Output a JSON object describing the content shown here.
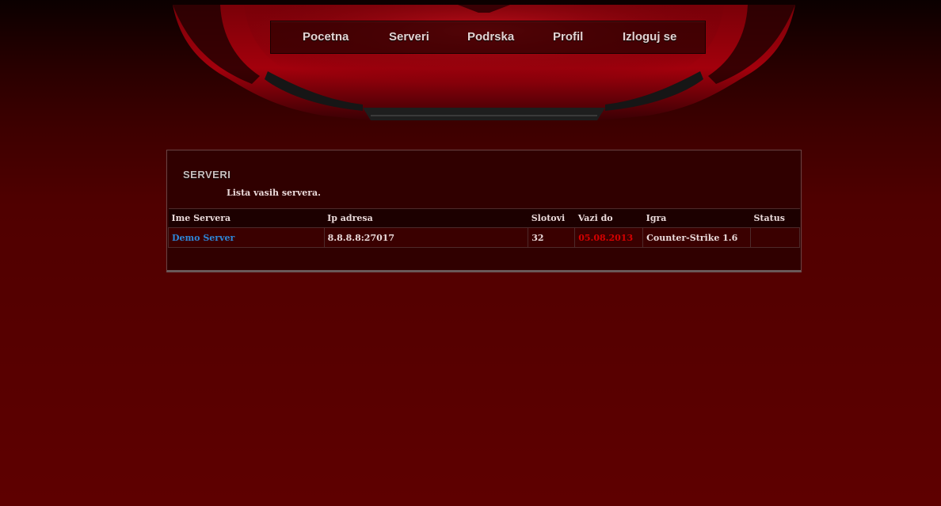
{
  "nav": {
    "items": [
      {
        "label": "Pocetna"
      },
      {
        "label": "Serveri"
      },
      {
        "label": "Podrska"
      },
      {
        "label": "Profil"
      },
      {
        "label": "Izloguj se"
      }
    ]
  },
  "panel": {
    "title": "SERVERI",
    "subtitle": "Lista vasih servera."
  },
  "table": {
    "headers": [
      "Ime Servera",
      "Ip adresa",
      "Slotovi",
      "Vazi do",
      "Igra",
      "Status"
    ],
    "rows": [
      {
        "name": "Demo Server",
        "ip": "8.8.8.8:27017",
        "slots": "32",
        "expires": "05.08.2013",
        "game": "Counter-Strike 1.6",
        "status": ""
      }
    ]
  },
  "colors": {
    "link": "#2e86d6",
    "expiry": "#d40000",
    "background": "#5e0000",
    "panel": "#300000"
  }
}
